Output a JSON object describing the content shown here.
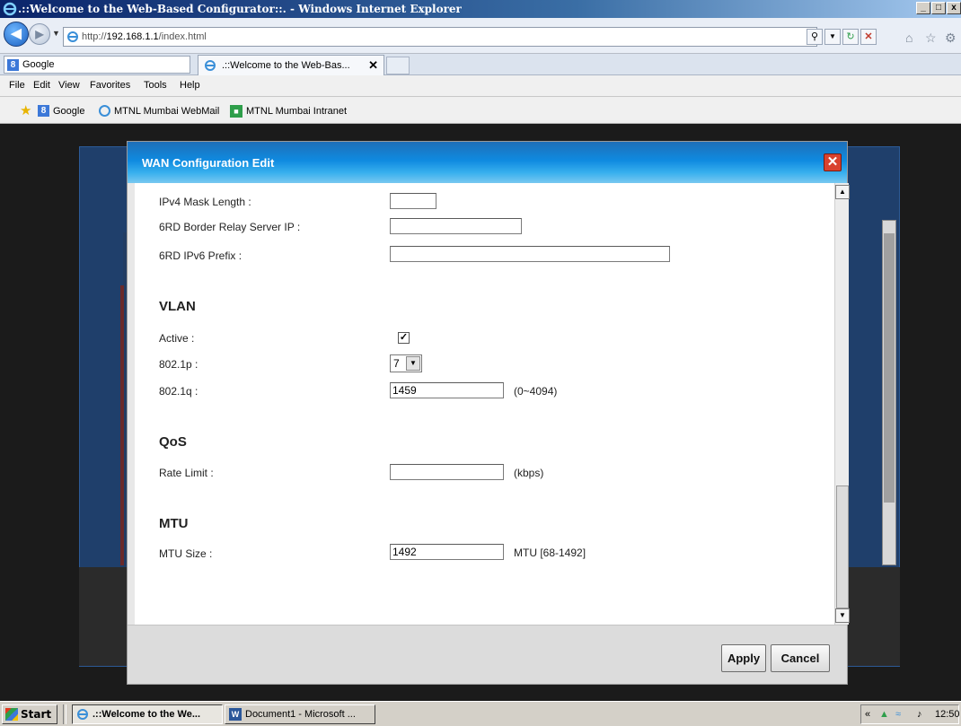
{
  "window": {
    "title": ".::Welcome to the Web-Based Configurator::. - Windows Internet Explorer",
    "controls": [
      "_",
      "□",
      "x"
    ]
  },
  "browser": {
    "url_prefix": "http://",
    "url_host": "192.168.1.1",
    "url_path": "/index.html",
    "google_label": "Google",
    "tab_title": ".::Welcome to the Web-Bas...",
    "tab_close": "✕",
    "menu": [
      "File",
      "Edit",
      "View",
      "Favorites",
      "Tools",
      "Help"
    ],
    "favorites": [
      "Google",
      "MTNL Mumbai WebMail",
      "MTNL Mumbai Intranet"
    ]
  },
  "dialog": {
    "title": "WAN Configuration Edit",
    "close": "✕",
    "fields": {
      "ipv4_mask_length": {
        "label": "IPv4 Mask Length :",
        "value": ""
      },
      "border_relay": {
        "label": "6RD Border Relay Server IP :",
        "value": ""
      },
      "ipv6_prefix": {
        "label": "6RD IPv6 Prefix :",
        "value": ""
      }
    },
    "vlan": {
      "heading": "VLAN",
      "active_label": "Active :",
      "active_checked": true,
      "p_label": "802.1p :",
      "p_value": "7",
      "q_label": "802.1q :",
      "q_value": "1459",
      "q_range": "(0~4094)"
    },
    "qos": {
      "heading": "QoS",
      "rate_label": "Rate Limit :",
      "rate_value": "",
      "rate_unit": "(kbps)"
    },
    "mtu": {
      "heading": "MTU",
      "size_label": "MTU Size :",
      "size_value": "1492",
      "size_range": "MTU [68-1492]"
    },
    "buttons": {
      "apply": "Apply",
      "cancel": "Cancel"
    }
  },
  "taskbar": {
    "start": "Start",
    "tasks": [
      ".::Welcome to the We...",
      "Document1 - Microsoft ..."
    ],
    "clock": "12:50"
  }
}
